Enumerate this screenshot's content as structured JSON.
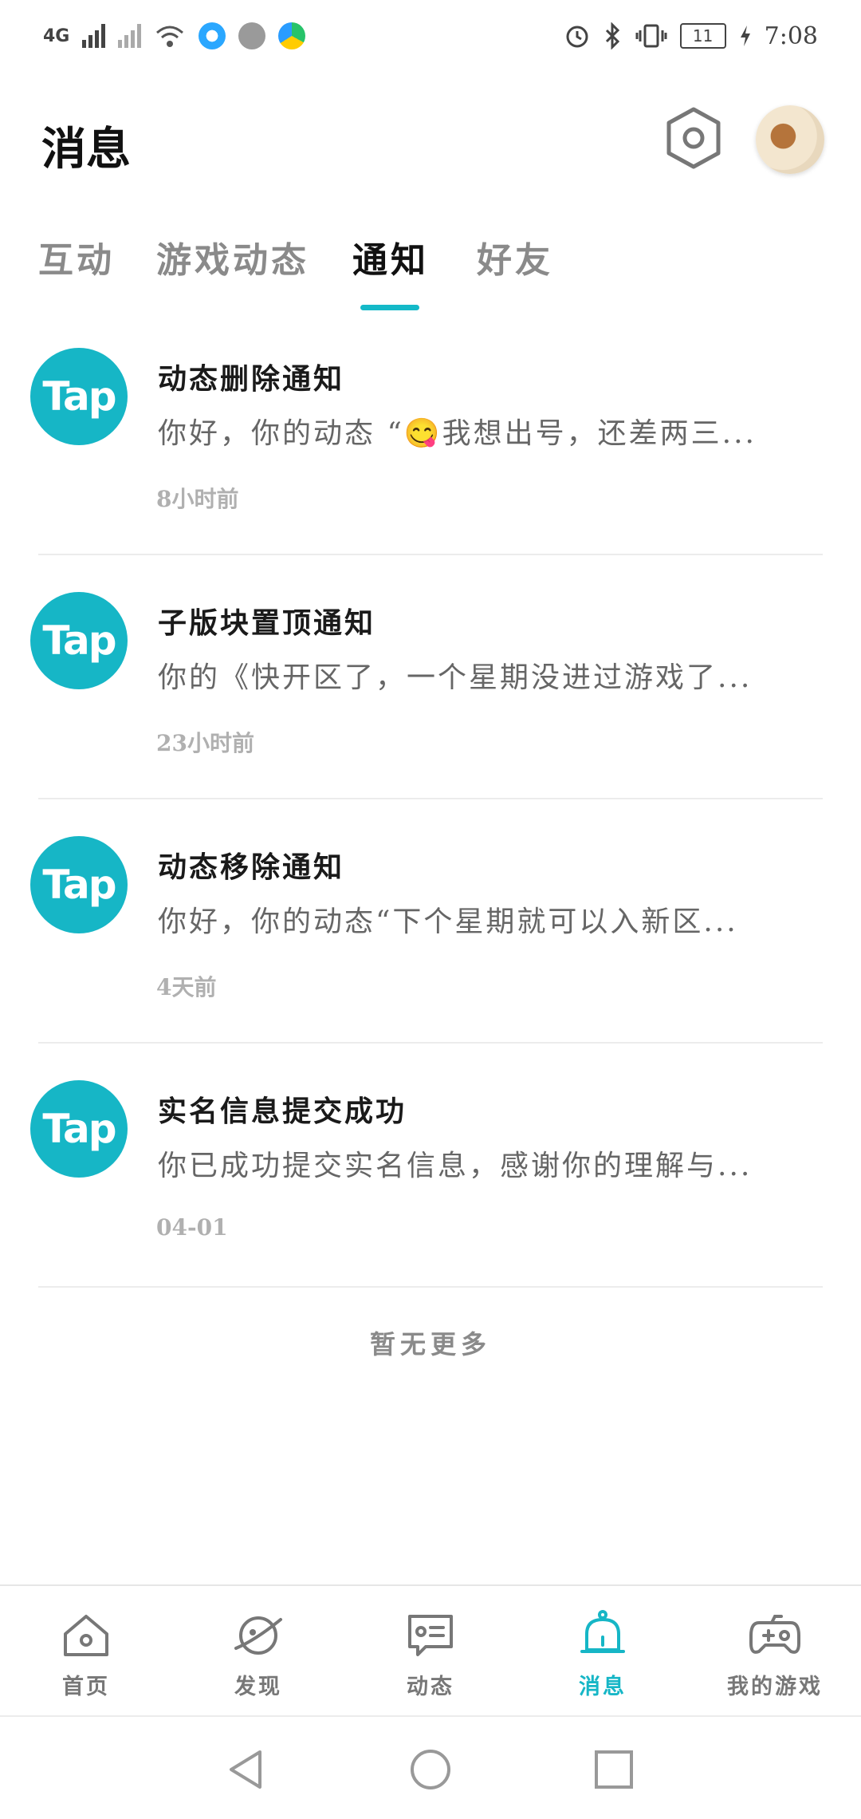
{
  "status_bar": {
    "network_label": "4G",
    "time": "7:08",
    "battery": "11"
  },
  "header": {
    "title": "消息",
    "icons": [
      "settings-hexagon-icon",
      "avatar"
    ]
  },
  "tabs": [
    {
      "label": "互动",
      "active": false
    },
    {
      "label": "游戏动态",
      "active": false
    },
    {
      "label": "通知",
      "active": true
    },
    {
      "label": "好友",
      "active": false
    }
  ],
  "notifications": [
    {
      "logo": "Tap",
      "title": "动态删除通知",
      "snippet": "你好，你的动态 “😋我想出号，还差两三...",
      "time": "8小时前"
    },
    {
      "logo": "Tap",
      "title": "子版块置顶通知",
      "snippet": "你的《快开区了，一个星期没进过游戏了...",
      "time": "23小时前"
    },
    {
      "logo": "Tap",
      "title": "动态移除通知",
      "snippet": "你好，你的动态“下个星期就可以入新区...",
      "time": "4天前"
    },
    {
      "logo": "Tap",
      "title": "实名信息提交成功",
      "snippet": "你已成功提交实名信息，感谢你的理解与...",
      "time": "04-01"
    }
  ],
  "list_footer": "暂无更多",
  "bottom_nav": [
    {
      "label": "首页",
      "icon": "home-icon",
      "active": false
    },
    {
      "label": "发现",
      "icon": "planet-icon",
      "active": false
    },
    {
      "label": "动态",
      "icon": "chat-card-icon",
      "active": false
    },
    {
      "label": "消息",
      "icon": "bell-icon",
      "active": true
    },
    {
      "label": "我的游戏",
      "icon": "gamepad-icon",
      "active": false
    }
  ],
  "colors": {
    "accent": "#16b6c6",
    "inactive_text": "#8a8a8a"
  }
}
